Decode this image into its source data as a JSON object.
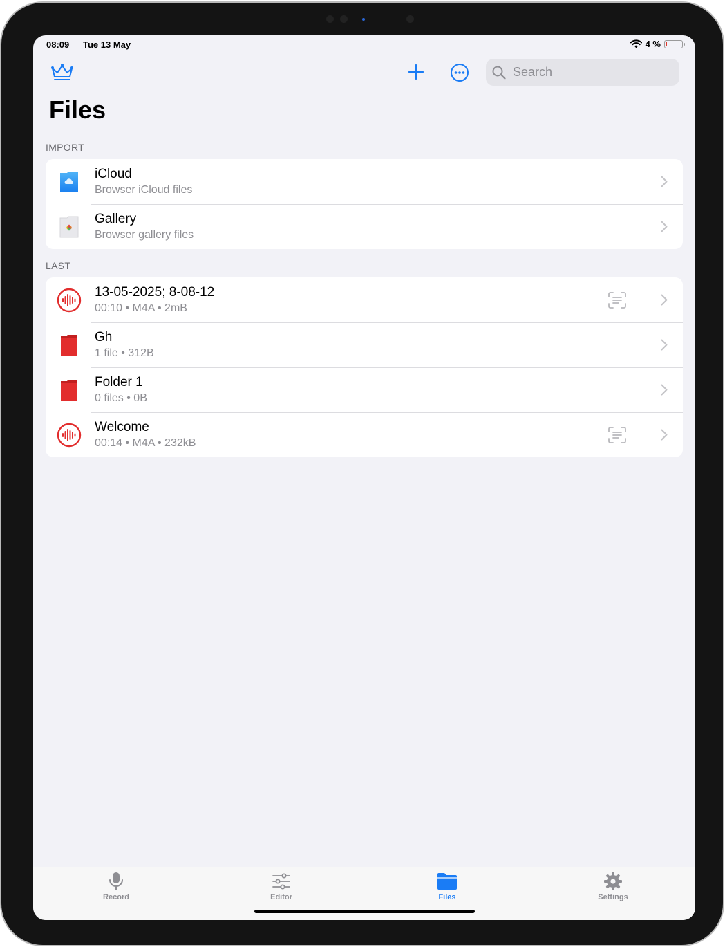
{
  "status": {
    "time": "08:09",
    "date": "Tue 13 May",
    "battery_text": "4 %",
    "battery_level": 0.04
  },
  "toolbar": {
    "premium_icon": "crown-icon",
    "add_icon": "plus-icon",
    "more_icon": "ellipsis-circle-icon"
  },
  "search": {
    "placeholder": "Search"
  },
  "page_title": "Files",
  "sections": {
    "import_label": "IMPORT",
    "last_label": "LAST"
  },
  "import_items": [
    {
      "title": "iCloud",
      "subtitle": "Browser iCloud files",
      "icon": "icloud-folder-icon"
    },
    {
      "title": "Gallery",
      "subtitle": "Browser gallery files",
      "icon": "photos-icon"
    }
  ],
  "last_items": [
    {
      "title": "13-05-2025; 8-08-12",
      "subtitle": "00:10 • M4A • 2mB",
      "icon": "waveform-icon",
      "has_transcript": true
    },
    {
      "title": "Gh",
      "subtitle": "1 file • 312B",
      "icon": "folder-icon",
      "has_transcript": false
    },
    {
      "title": "Folder 1",
      "subtitle": "0 files • 0B",
      "icon": "folder-icon",
      "has_transcript": false
    },
    {
      "title": "Welcome",
      "subtitle": "00:14 • M4A • 232kB",
      "icon": "waveform-icon",
      "has_transcript": true
    }
  ],
  "tabs": [
    {
      "label": "Record",
      "icon": "microphone-icon"
    },
    {
      "label": "Editor",
      "icon": "sliders-icon"
    },
    {
      "label": "Files",
      "icon": "folder-icon",
      "active": true
    },
    {
      "label": "Settings",
      "icon": "gear-icon"
    }
  ],
  "colors": {
    "accent": "#1a7cf5",
    "folder_red": "#e22d2d",
    "background": "#f2f2f7",
    "tab_inactive": "#8e8e93"
  }
}
